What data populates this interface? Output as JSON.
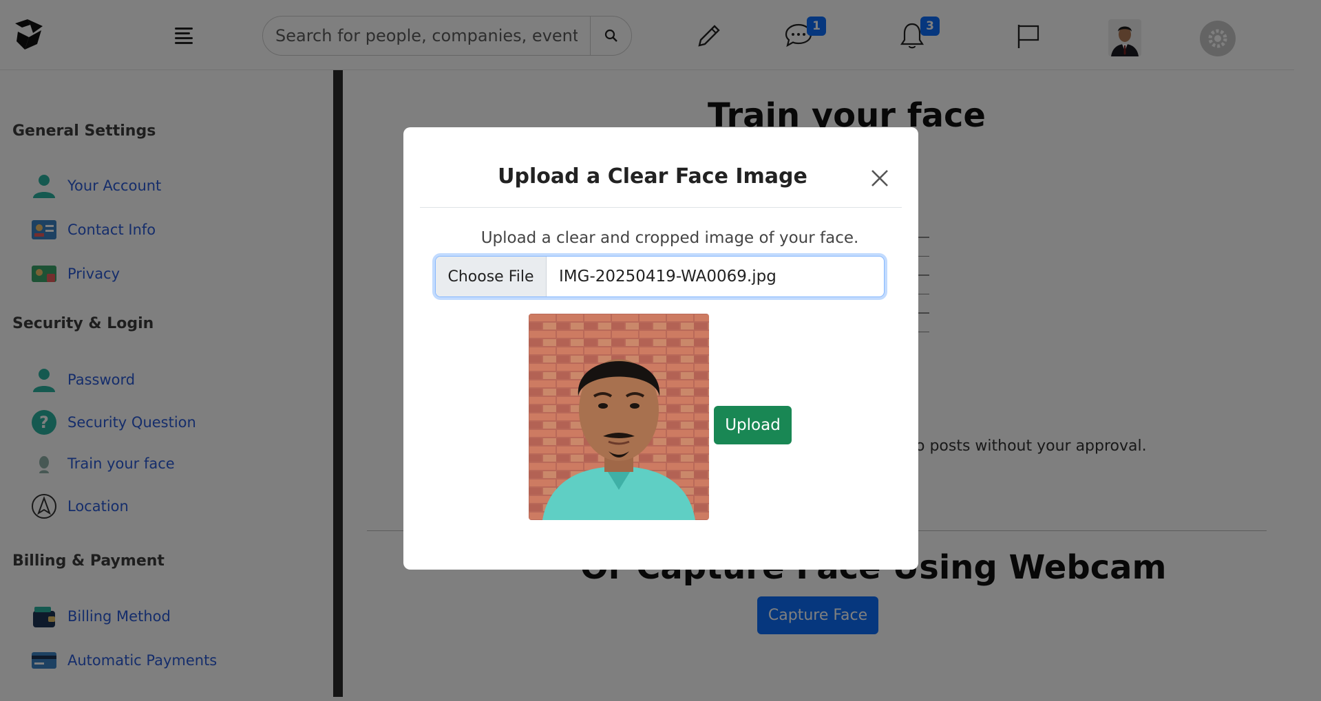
{
  "navbar": {
    "search": {
      "placeholder": "Search for people, companies, events and"
    },
    "messages": {
      "badge": "1"
    },
    "notifications": {
      "badge": "3"
    }
  },
  "sidebar": {
    "sections": [
      {
        "heading": "General Settings",
        "items": [
          {
            "label": "Your Account",
            "icon": "user-icon"
          },
          {
            "label": "Contact Info",
            "icon": "contact-card-icon"
          },
          {
            "label": "Privacy",
            "icon": "privacy-icon"
          }
        ]
      },
      {
        "heading": "Security & Login",
        "items": [
          {
            "label": "Password",
            "icon": "user-icon"
          },
          {
            "label": "Security Question",
            "icon": "question-icon"
          },
          {
            "label": "Train your face",
            "icon": "face-icon"
          },
          {
            "label": "Location",
            "icon": "location-icon"
          }
        ]
      },
      {
        "heading": "Billing & Payment",
        "items": [
          {
            "label": "Billing Method",
            "icon": "wallet-icon"
          },
          {
            "label": "Automatic Payments",
            "icon": "credit-card-icon"
          }
        ]
      }
    ]
  },
  "main": {
    "title": "Train your face",
    "text_fragment": "o posts without your approval.",
    "webcam_title": "Or Capture Face Using Webcam",
    "capture_button": "Capture Face"
  },
  "modal": {
    "title": "Upload a Clear Face Image",
    "description": "Upload a clear and cropped image of your face.",
    "file_button": "Choose File",
    "file_name": "IMG-20250419-WA0069.jpg",
    "upload_button": "Upload"
  },
  "colors": {
    "primary": "#0d6efd",
    "success": "#198754",
    "link": "#2a5bd7"
  }
}
